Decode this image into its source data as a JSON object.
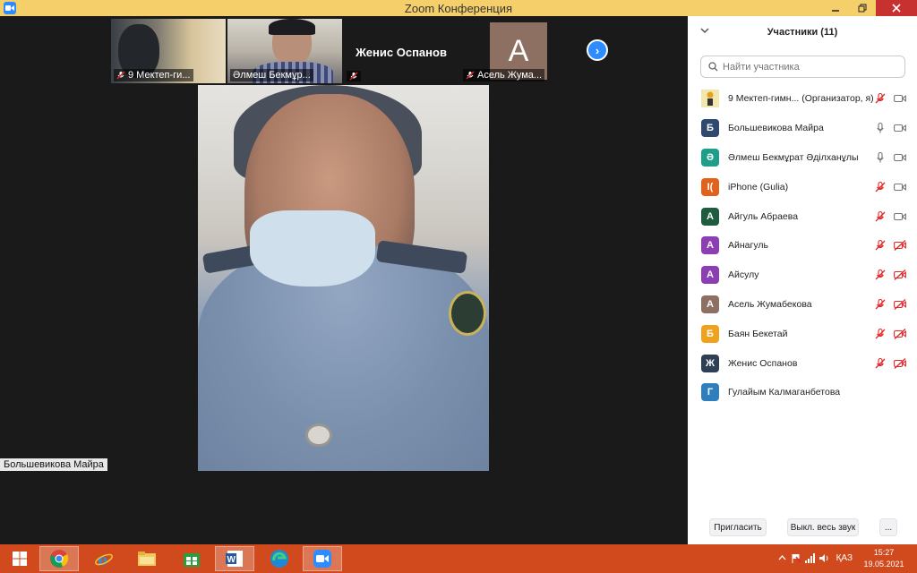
{
  "window": {
    "title": "Zoom Конференция"
  },
  "thumbnails": [
    {
      "label": "9 Мектеп-ги..."
    },
    {
      "label": "Әлмеш Бекмұр..."
    },
    {
      "name": "Женис Оспанов"
    },
    {
      "label": "Асель Жума...",
      "initial": "А",
      "color": "#8e7062"
    }
  ],
  "main_video": {
    "speaker_label": "Большевикова Майра"
  },
  "panel": {
    "title": "Участники (11)",
    "search_placeholder": "Найти участника",
    "participants": [
      {
        "name": "9 Мектеп-гимн... (Организатор, я)",
        "initial": "",
        "color": "#e6c24a",
        "mic": "muted",
        "video": "on"
      },
      {
        "name": "Большевикова Майра",
        "initial": "Б",
        "color": "#2f4a6e",
        "mic": "on",
        "video": "on"
      },
      {
        "name": "Әлмеш Бекмұрат Әділханұлы",
        "initial": "Ә",
        "color": "#1f9e8a",
        "mic": "on",
        "video": "on"
      },
      {
        "name": "iPhone (Gulia)",
        "initial": "I(",
        "color": "#e0621d",
        "mic": "muted",
        "video": "on"
      },
      {
        "name": "Айгуль Абраева",
        "initial": "А",
        "color": "#1f5c3e",
        "mic": "muted",
        "video": "on"
      },
      {
        "name": "Айнагуль",
        "initial": "А",
        "color": "#8c3fb3",
        "mic": "muted",
        "video": "off"
      },
      {
        "name": "Айсулу",
        "initial": "А",
        "color": "#8c3fb3",
        "mic": "muted",
        "video": "off"
      },
      {
        "name": "Асель Жумабекова",
        "initial": "А",
        "color": "#8e7062",
        "mic": "muted",
        "video": "off"
      },
      {
        "name": "Баян Бекетай",
        "initial": "Б",
        "color": "#f0a21e",
        "mic": "muted",
        "video": "off"
      },
      {
        "name": "Женис Оспанов",
        "initial": "Ж",
        "color": "#2f3f55",
        "mic": "muted",
        "video": "off"
      },
      {
        "name": "Гулайым Калмаганбетова",
        "initial": "Г",
        "color": "#2f7fbf",
        "mic": "none",
        "video": "none"
      }
    ],
    "invite_label": "Пригласить",
    "mute_all_label": "Выкл. весь звук",
    "more_label": "..."
  },
  "taskbar": {
    "lang": "ҚАЗ",
    "time": "15:27",
    "date": "19.05.2021"
  }
}
